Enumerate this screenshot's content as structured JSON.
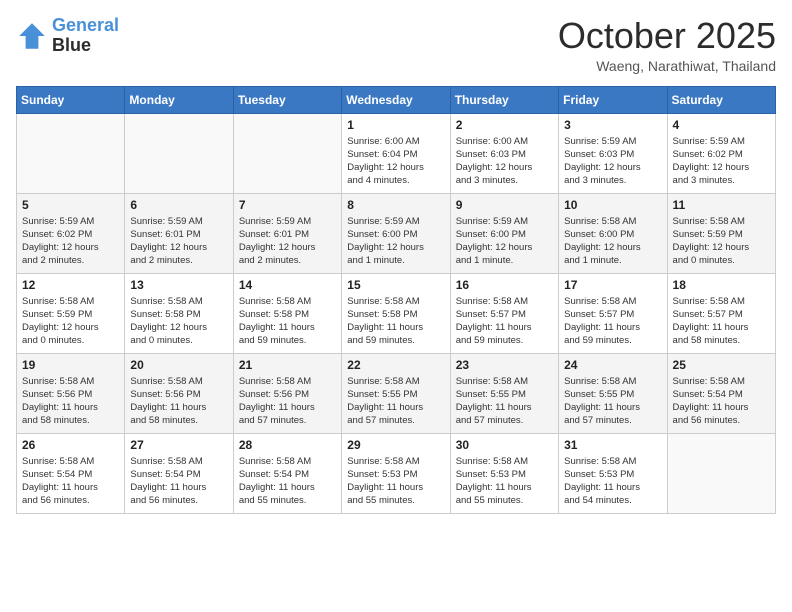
{
  "header": {
    "logo_line1": "General",
    "logo_line2": "Blue",
    "month": "October 2025",
    "location": "Waeng, Narathiwat, Thailand"
  },
  "weekdays": [
    "Sunday",
    "Monday",
    "Tuesday",
    "Wednesday",
    "Thursday",
    "Friday",
    "Saturday"
  ],
  "weeks": [
    [
      {
        "day": "",
        "info": ""
      },
      {
        "day": "",
        "info": ""
      },
      {
        "day": "",
        "info": ""
      },
      {
        "day": "1",
        "info": "Sunrise: 6:00 AM\nSunset: 6:04 PM\nDaylight: 12 hours\nand 4 minutes."
      },
      {
        "day": "2",
        "info": "Sunrise: 6:00 AM\nSunset: 6:03 PM\nDaylight: 12 hours\nand 3 minutes."
      },
      {
        "day": "3",
        "info": "Sunrise: 5:59 AM\nSunset: 6:03 PM\nDaylight: 12 hours\nand 3 minutes."
      },
      {
        "day": "4",
        "info": "Sunrise: 5:59 AM\nSunset: 6:02 PM\nDaylight: 12 hours\nand 3 minutes."
      }
    ],
    [
      {
        "day": "5",
        "info": "Sunrise: 5:59 AM\nSunset: 6:02 PM\nDaylight: 12 hours\nand 2 minutes."
      },
      {
        "day": "6",
        "info": "Sunrise: 5:59 AM\nSunset: 6:01 PM\nDaylight: 12 hours\nand 2 minutes."
      },
      {
        "day": "7",
        "info": "Sunrise: 5:59 AM\nSunset: 6:01 PM\nDaylight: 12 hours\nand 2 minutes."
      },
      {
        "day": "8",
        "info": "Sunrise: 5:59 AM\nSunset: 6:00 PM\nDaylight: 12 hours\nand 1 minute."
      },
      {
        "day": "9",
        "info": "Sunrise: 5:59 AM\nSunset: 6:00 PM\nDaylight: 12 hours\nand 1 minute."
      },
      {
        "day": "10",
        "info": "Sunrise: 5:58 AM\nSunset: 6:00 PM\nDaylight: 12 hours\nand 1 minute."
      },
      {
        "day": "11",
        "info": "Sunrise: 5:58 AM\nSunset: 5:59 PM\nDaylight: 12 hours\nand 0 minutes."
      }
    ],
    [
      {
        "day": "12",
        "info": "Sunrise: 5:58 AM\nSunset: 5:59 PM\nDaylight: 12 hours\nand 0 minutes."
      },
      {
        "day": "13",
        "info": "Sunrise: 5:58 AM\nSunset: 5:58 PM\nDaylight: 12 hours\nand 0 minutes."
      },
      {
        "day": "14",
        "info": "Sunrise: 5:58 AM\nSunset: 5:58 PM\nDaylight: 11 hours\nand 59 minutes."
      },
      {
        "day": "15",
        "info": "Sunrise: 5:58 AM\nSunset: 5:58 PM\nDaylight: 11 hours\nand 59 minutes."
      },
      {
        "day": "16",
        "info": "Sunrise: 5:58 AM\nSunset: 5:57 PM\nDaylight: 11 hours\nand 59 minutes."
      },
      {
        "day": "17",
        "info": "Sunrise: 5:58 AM\nSunset: 5:57 PM\nDaylight: 11 hours\nand 59 minutes."
      },
      {
        "day": "18",
        "info": "Sunrise: 5:58 AM\nSunset: 5:57 PM\nDaylight: 11 hours\nand 58 minutes."
      }
    ],
    [
      {
        "day": "19",
        "info": "Sunrise: 5:58 AM\nSunset: 5:56 PM\nDaylight: 11 hours\nand 58 minutes."
      },
      {
        "day": "20",
        "info": "Sunrise: 5:58 AM\nSunset: 5:56 PM\nDaylight: 11 hours\nand 58 minutes."
      },
      {
        "day": "21",
        "info": "Sunrise: 5:58 AM\nSunset: 5:56 PM\nDaylight: 11 hours\nand 57 minutes."
      },
      {
        "day": "22",
        "info": "Sunrise: 5:58 AM\nSunset: 5:55 PM\nDaylight: 11 hours\nand 57 minutes."
      },
      {
        "day": "23",
        "info": "Sunrise: 5:58 AM\nSunset: 5:55 PM\nDaylight: 11 hours\nand 57 minutes."
      },
      {
        "day": "24",
        "info": "Sunrise: 5:58 AM\nSunset: 5:55 PM\nDaylight: 11 hours\nand 57 minutes."
      },
      {
        "day": "25",
        "info": "Sunrise: 5:58 AM\nSunset: 5:54 PM\nDaylight: 11 hours\nand 56 minutes."
      }
    ],
    [
      {
        "day": "26",
        "info": "Sunrise: 5:58 AM\nSunset: 5:54 PM\nDaylight: 11 hours\nand 56 minutes."
      },
      {
        "day": "27",
        "info": "Sunrise: 5:58 AM\nSunset: 5:54 PM\nDaylight: 11 hours\nand 56 minutes."
      },
      {
        "day": "28",
        "info": "Sunrise: 5:58 AM\nSunset: 5:54 PM\nDaylight: 11 hours\nand 55 minutes."
      },
      {
        "day": "29",
        "info": "Sunrise: 5:58 AM\nSunset: 5:53 PM\nDaylight: 11 hours\nand 55 minutes."
      },
      {
        "day": "30",
        "info": "Sunrise: 5:58 AM\nSunset: 5:53 PM\nDaylight: 11 hours\nand 55 minutes."
      },
      {
        "day": "31",
        "info": "Sunrise: 5:58 AM\nSunset: 5:53 PM\nDaylight: 11 hours\nand 54 minutes."
      },
      {
        "day": "",
        "info": ""
      }
    ]
  ]
}
